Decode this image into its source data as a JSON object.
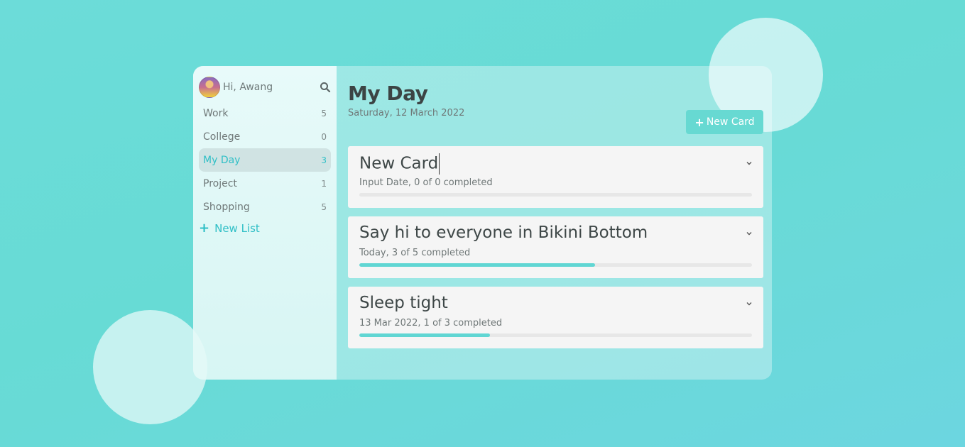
{
  "user": {
    "greeting": "Hi, Awang"
  },
  "lists": [
    {
      "label": "Work",
      "count": "5",
      "active": false
    },
    {
      "label": "College",
      "count": "0",
      "active": false
    },
    {
      "label": "My Day",
      "count": "3",
      "active": true
    },
    {
      "label": "Project",
      "count": "1",
      "active": false
    },
    {
      "label": "Shopping",
      "count": "5",
      "active": false
    }
  ],
  "new_list_label": "New List",
  "main": {
    "title": "My Day",
    "date": "Saturday, 12 March 2022",
    "new_card_label": "New Card"
  },
  "cards": [
    {
      "title": "New Card",
      "meta": "Input Date, 0 of 0 completed",
      "progress": 0,
      "editing": true
    },
    {
      "title": "Say hi to everyone in Bikini Bottom",
      "meta": "Today, 3 of 5 completed",
      "progress": 0.6,
      "editing": false
    },
    {
      "title": "Sleep tight",
      "meta": "13 Mar 2022, 1 of 3 completed",
      "progress": 0.333,
      "editing": false
    }
  ],
  "colors": {
    "accent": "#2fbfc6",
    "button": "#67d9d2",
    "progress": "#60d6d3"
  },
  "icons": {
    "search": "search-icon",
    "chevron": "chevron-down-icon",
    "plus": "plus-icon"
  }
}
